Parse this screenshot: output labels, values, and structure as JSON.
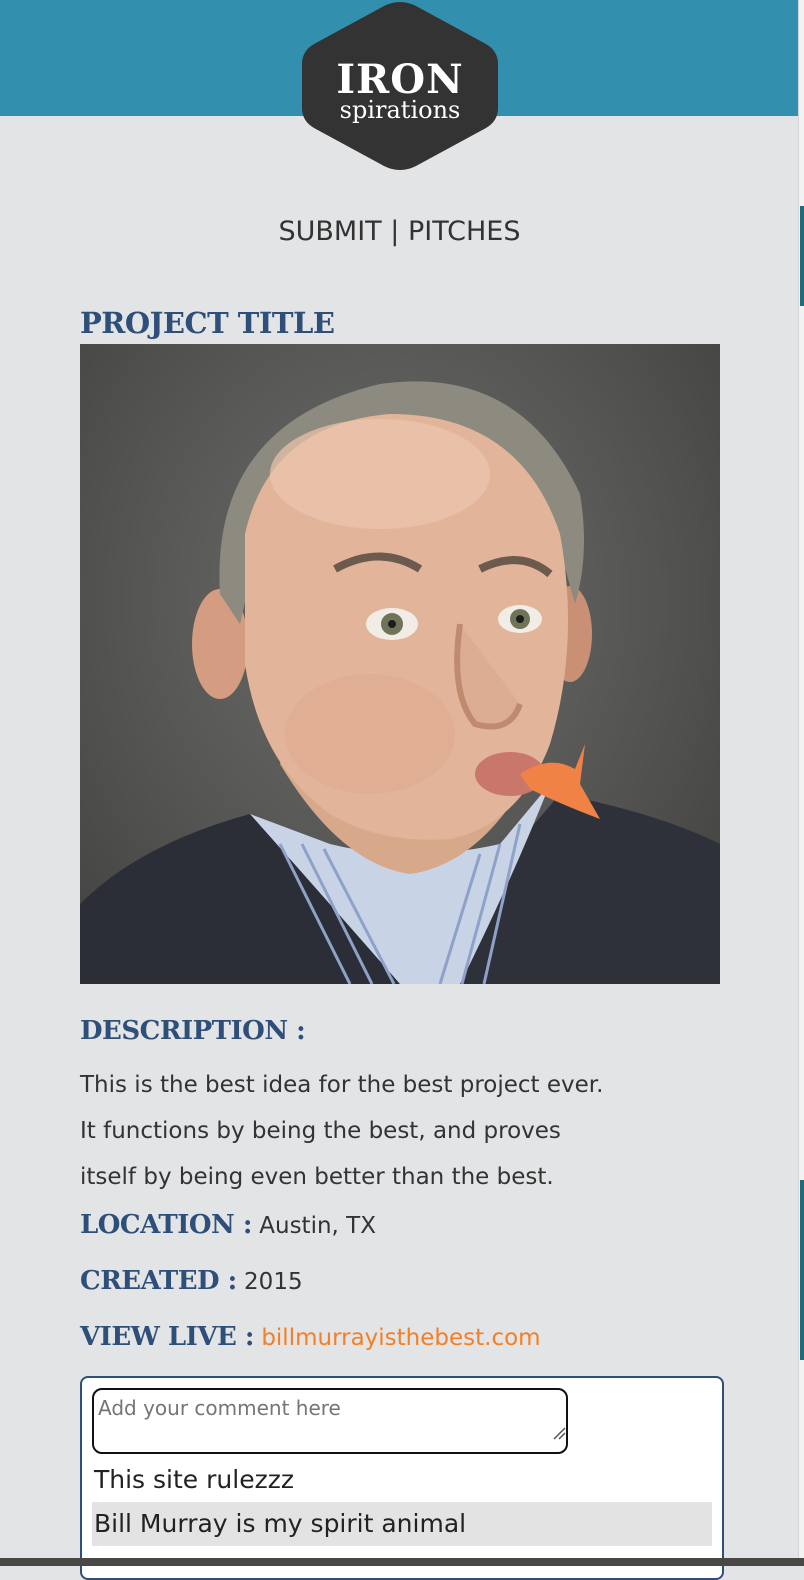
{
  "logo": {
    "line1": "IRON",
    "line2": "spirations"
  },
  "nav": {
    "submit_label": "SUBMIT",
    "separator": "|",
    "pitches_label": "PITCHES"
  },
  "project": {
    "title": "PROJECT TITLE",
    "image_icon": "portrait-photo",
    "description_label": "DESCRIPTION :",
    "description_lines": [
      "This is the best idea for the best project ever.",
      "It functions by being the best, and proves",
      "itself by being even better than the best."
    ],
    "location_label": "LOCATION :",
    "location_value": "Austin, TX",
    "created_label": "CREATED :",
    "created_value": "2015",
    "view_live_label": "VIEW LIVE :",
    "view_live_link": "billmurrayisthebest.com"
  },
  "comments": {
    "placeholder": "Add your comment here",
    "items": [
      "This site rulezzz",
      "Bill Murray is my spirit animal"
    ]
  },
  "colors": {
    "header_bar": "#338fae",
    "logo_hex": "#333333",
    "heading": "#2e4f7a",
    "link": "#f47f24",
    "page_bg": "#e3e4e6"
  }
}
